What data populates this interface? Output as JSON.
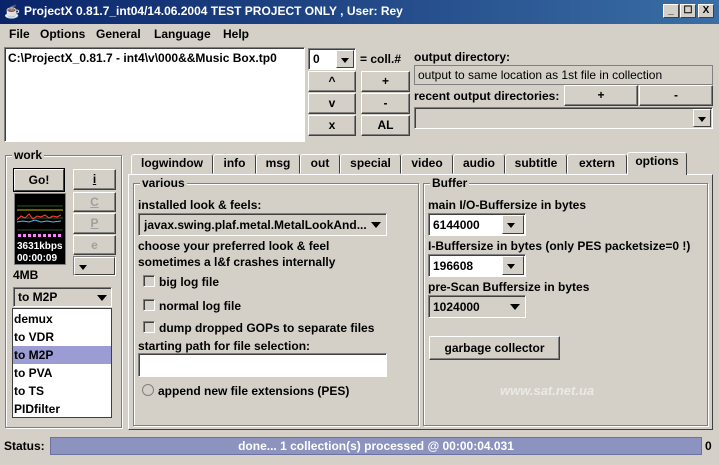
{
  "window": {
    "title": "ProjectX 0.81.7_int04/14.06.2004 TEST PROJECT ONLY , User: Rey",
    "minimize": "_",
    "maximize": "☐",
    "close": "X"
  },
  "menu": [
    {
      "label": "File"
    },
    {
      "label": "Options"
    },
    {
      "label": "General"
    },
    {
      "label": "Language"
    },
    {
      "label": "Help"
    }
  ],
  "collection": {
    "file": "C:\\ProjectX_0.81.7 - int4\\v\\000&&Music Box.tp0",
    "index": "0",
    "coll_label": "= coll.#",
    "btn_up": "^",
    "btn_down": "v",
    "btn_x": "x",
    "btn_add": "+",
    "btn_remove": "-",
    "btn_al": "AL"
  },
  "output": {
    "label": "output directory:",
    "value": "output to same location as 1st file in collection",
    "recent_label": "recent output directories:",
    "recent_add": "+",
    "recent_remove": "-"
  },
  "work": {
    "title": "work",
    "go": "Go!",
    "btn_i": "i",
    "btn_c": "C",
    "btn_p": "P",
    "btn_e": "e",
    "bitrate": "3631kbps",
    "time": "00:00:09",
    "size": "4MB",
    "mode_selected": "to M2P",
    "modes": [
      "demux",
      "to VDR",
      "to M2P",
      "to PVA",
      "to TS",
      "PIDfilter"
    ],
    "selected_index": 2
  },
  "tabs": [
    "logwindow",
    "info",
    "msg",
    "out",
    "special",
    "video",
    "audio",
    "subtitle",
    "extern",
    "options"
  ],
  "active_tab": "options",
  "various": {
    "title": "various",
    "installed_label": "installed look & feels:",
    "laf_value": "javax.swing.plaf.metal.MetalLookAnd...",
    "choose_text_1": "choose your preferred look & feel",
    "choose_text_2": "sometimes a l&f crashes internally",
    "big_log": "big log file",
    "normal_log": "normal log file",
    "dump_gops": "dump dropped GOPs to separate files",
    "start_path_label": "starting path for file selection:",
    "start_path_value": "",
    "append_ext": "append new file extensions (PES)"
  },
  "buffer": {
    "title": "Buffer",
    "main_label": "main I/O-Buffersize in bytes",
    "main_value": "6144000",
    "i_label": "I-Buffersize in bytes (only PES packetsize=0 !)",
    "i_value": "196608",
    "prescan_label": "pre-Scan Buffersize in bytes",
    "prescan_value": "1024000",
    "gc_button": "garbage collector"
  },
  "watermark": "www.sat.net.ua",
  "status": {
    "label": "Status:",
    "text": "done...   1 collection(s) processed  @  00:00:04.031",
    "right_value": "0"
  },
  "colors": {
    "title_gradient_start": "#0a246a",
    "title_gradient_end": "#3a6ea5",
    "selection": "#9c9cd4",
    "status_fill": "#8c93bf"
  }
}
